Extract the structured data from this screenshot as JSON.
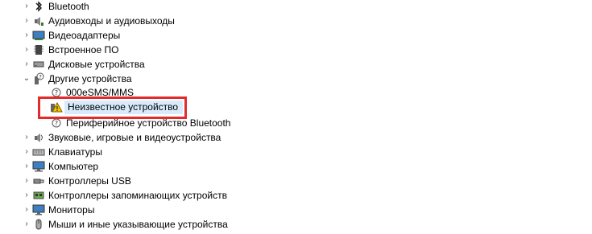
{
  "tree": {
    "items": [
      {
        "label": "Bluetooth",
        "icon": "bluetooth-icon"
      },
      {
        "label": "Аудиовходы и аудиовыходы",
        "icon": "speaker-icon"
      },
      {
        "label": "Видеоадаптеры",
        "icon": "display-adapter-icon"
      },
      {
        "label": "Встроенное ПО",
        "icon": "firmware-icon"
      },
      {
        "label": "Дисковые устройства",
        "icon": "disk-drive-icon"
      },
      {
        "label": "Другие устройства",
        "icon": "other-devices-icon",
        "expanded": true
      },
      {
        "label": "000eSMS/MMS",
        "icon": "unknown-device-icon"
      },
      {
        "label": "Неизвестное устройство",
        "icon": "unknown-device-warning-icon",
        "selected": true
      },
      {
        "label": "Периферийное устройство Bluetooth",
        "icon": "unknown-device-icon"
      },
      {
        "label": "Звуковые, игровые и видеоустройства",
        "icon": "sound-icon"
      },
      {
        "label": "Клавиатуры",
        "icon": "keyboard-icon"
      },
      {
        "label": "Компьютер",
        "icon": "computer-icon"
      },
      {
        "label": "Контроллеры USB",
        "icon": "usb-icon"
      },
      {
        "label": "Контроллеры запоминающих устройств",
        "icon": "storage-controller-icon"
      },
      {
        "label": "Мониторы",
        "icon": "monitor-icon"
      },
      {
        "label": "Мыши и иные указывающие устройства",
        "icon": "mouse-icon"
      }
    ]
  },
  "colors": {
    "highlight_border": "#e32b2b",
    "selection": "#d9ebfb"
  }
}
